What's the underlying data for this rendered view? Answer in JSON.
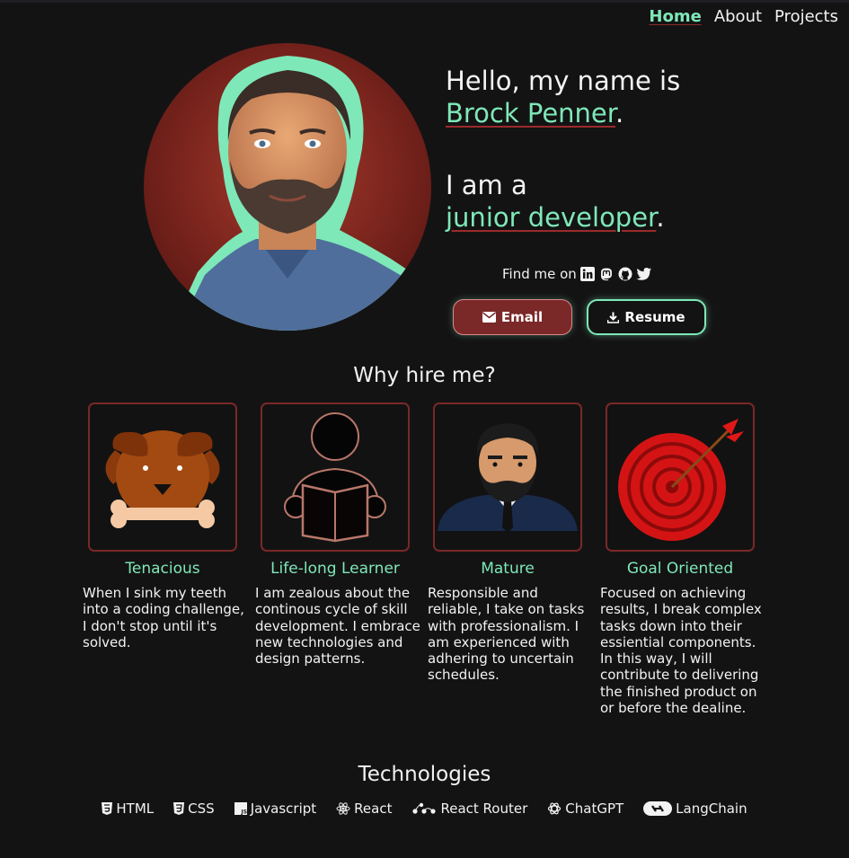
{
  "nav": {
    "home": "Home",
    "about": "About",
    "projects": "Projects"
  },
  "hero": {
    "line1": "Hello, my name is",
    "name": "Brock Penner",
    "name_suffix": ".",
    "line3": "I am a",
    "role": "junior developer",
    "role_suffix": "."
  },
  "social": {
    "label": "Find me on",
    "icons": [
      "linkedin-icon",
      "mastodon-icon",
      "github-icon",
      "twitter-icon"
    ]
  },
  "buttons": {
    "email": "Email",
    "resume": "Resume"
  },
  "why": {
    "title": "Why hire me?",
    "cards": [
      {
        "title": "Tenacious",
        "text": "When I sink my teeth into a coding challenge, I don't stop until it's solved."
      },
      {
        "title": "Life-long Learner",
        "text": "I am zealous about the continous cycle of skill development. I embrace new technologies and design patterns."
      },
      {
        "title": "Mature",
        "text": "Responsible and reliable, I take on tasks with professionalism. I am experienced with adhering to uncertain schedules."
      },
      {
        "title": "Goal Oriented",
        "text": "Focused on achieving results, I break complex tasks down into their essiential components. In this way, I will contribute to delivering the finished product on or before the dealine."
      }
    ]
  },
  "technologies": {
    "title": "Technologies",
    "items": [
      {
        "label": "HTML",
        "icon": "html5-icon"
      },
      {
        "label": "CSS",
        "icon": "css3-icon"
      },
      {
        "label": "Javascript",
        "icon": "js-icon"
      },
      {
        "label": "React",
        "icon": "react-icon"
      },
      {
        "label": "React Router",
        "icon": "react-router-icon"
      },
      {
        "label": "ChatGPT",
        "icon": "openai-icon"
      },
      {
        "label": "LangChain",
        "icon": "langchain-icon"
      }
    ]
  },
  "colors": {
    "background": "#141314",
    "accent_mint": "#7ee8b8",
    "accent_maroon": "#7a2828"
  }
}
